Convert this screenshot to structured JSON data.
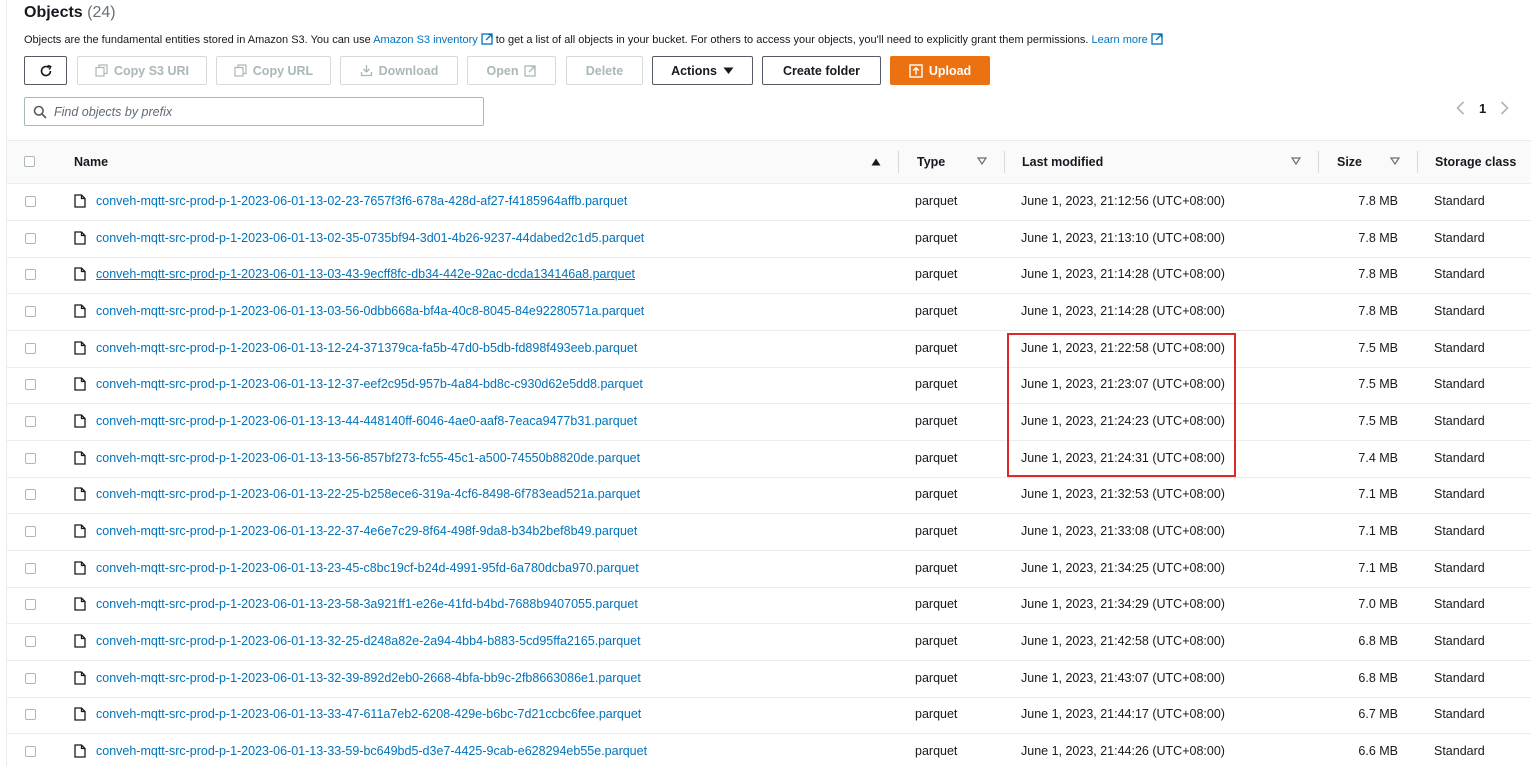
{
  "header": {
    "title": "Objects",
    "count": "(24)",
    "description_part1": "Objects are the fundamental entities stored in Amazon S3. You can use",
    "inventory_link": "Amazon S3 inventory",
    "description_part2": "to get a list of all objects in your bucket. For others to access your objects, you'll need to explicitly grant them permissions.",
    "learn_more_link": "Learn more"
  },
  "toolbar": {
    "copy_s3_uri": "Copy S3 URI",
    "copy_url": "Copy URL",
    "download": "Download",
    "open": "Open",
    "delete": "Delete",
    "actions": "Actions",
    "create_folder": "Create folder",
    "upload": "Upload"
  },
  "search": {
    "placeholder": "Find objects by prefix",
    "value": ""
  },
  "pagination": {
    "current_page": "1"
  },
  "table": {
    "columns": [
      "Name",
      "Type",
      "Last modified",
      "Size",
      "Storage class"
    ],
    "rows": [
      {
        "name": "conveh-mqtt-src-prod-p-1-2023-06-01-13-02-23-7657f3f6-678a-428d-af27-f4185964affb.parquet",
        "type": "parquet",
        "modified": "June 1, 2023, 21:12:56 (UTC+08:00)",
        "size": "7.8 MB",
        "storage": "Standard"
      },
      {
        "name": "conveh-mqtt-src-prod-p-1-2023-06-01-13-02-35-0735bf94-3d01-4b26-9237-44dabed2c1d5.parquet",
        "type": "parquet",
        "modified": "June 1, 2023, 21:13:10 (UTC+08:00)",
        "size": "7.8 MB",
        "storage": "Standard"
      },
      {
        "name": "conveh-mqtt-src-prod-p-1-2023-06-01-13-03-43-9ecff8fc-db34-442e-92ac-dcda134146a8.parquet",
        "type": "parquet",
        "modified": "June 1, 2023, 21:14:28 (UTC+08:00)",
        "size": "7.8 MB",
        "storage": "Standard"
      },
      {
        "name": "conveh-mqtt-src-prod-p-1-2023-06-01-13-03-56-0dbb668a-bf4a-40c8-8045-84e92280571a.parquet",
        "type": "parquet",
        "modified": "June 1, 2023, 21:14:28 (UTC+08:00)",
        "size": "7.8 MB",
        "storage": "Standard"
      },
      {
        "name": "conveh-mqtt-src-prod-p-1-2023-06-01-13-12-24-371379ca-fa5b-47d0-b5db-fd898f493eeb.parquet",
        "type": "parquet",
        "modified": "June 1, 2023, 21:22:58 (UTC+08:00)",
        "size": "7.5 MB",
        "storage": "Standard"
      },
      {
        "name": "conveh-mqtt-src-prod-p-1-2023-06-01-13-12-37-eef2c95d-957b-4a84-bd8c-c930d62e5dd8.parquet",
        "type": "parquet",
        "modified": "June 1, 2023, 21:23:07 (UTC+08:00)",
        "size": "7.5 MB",
        "storage": "Standard"
      },
      {
        "name": "conveh-mqtt-src-prod-p-1-2023-06-01-13-13-44-448140ff-6046-4ae0-aaf8-7eaca9477b31.parquet",
        "type": "parquet",
        "modified": "June 1, 2023, 21:24:23 (UTC+08:00)",
        "size": "7.5 MB",
        "storage": "Standard"
      },
      {
        "name": "conveh-mqtt-src-prod-p-1-2023-06-01-13-13-56-857bf273-fc55-45c1-a500-74550b8820de.parquet",
        "type": "parquet",
        "modified": "June 1, 2023, 21:24:31 (UTC+08:00)",
        "size": "7.4 MB",
        "storage": "Standard"
      },
      {
        "name": "conveh-mqtt-src-prod-p-1-2023-06-01-13-22-25-b258ece6-319a-4cf6-8498-6f783ead521a.parquet",
        "type": "parquet",
        "modified": "June 1, 2023, 21:32:53 (UTC+08:00)",
        "size": "7.1 MB",
        "storage": "Standard"
      },
      {
        "name": "conveh-mqtt-src-prod-p-1-2023-06-01-13-22-37-4e6e7c29-8f64-498f-9da8-b34b2bef8b49.parquet",
        "type": "parquet",
        "modified": "June 1, 2023, 21:33:08 (UTC+08:00)",
        "size": "7.1 MB",
        "storage": "Standard"
      },
      {
        "name": "conveh-mqtt-src-prod-p-1-2023-06-01-13-23-45-c8bc19cf-b24d-4991-95fd-6a780dcba970.parquet",
        "type": "parquet",
        "modified": "June 1, 2023, 21:34:25 (UTC+08:00)",
        "size": "7.1 MB",
        "storage": "Standard"
      },
      {
        "name": "conveh-mqtt-src-prod-p-1-2023-06-01-13-23-58-3a921ff1-e26e-41fd-b4bd-7688b9407055.parquet",
        "type": "parquet",
        "modified": "June 1, 2023, 21:34:29 (UTC+08:00)",
        "size": "7.0 MB",
        "storage": "Standard"
      },
      {
        "name": "conveh-mqtt-src-prod-p-1-2023-06-01-13-32-25-d248a82e-2a94-4bb4-b883-5cd95ffa2165.parquet",
        "type": "parquet",
        "modified": "June 1, 2023, 21:42:58 (UTC+08:00)",
        "size": "6.8 MB",
        "storage": "Standard"
      },
      {
        "name": "conveh-mqtt-src-prod-p-1-2023-06-01-13-32-39-892d2eb0-2668-4bfa-bb9c-2fb8663086e1.parquet",
        "type": "parquet",
        "modified": "June 1, 2023, 21:43:07 (UTC+08:00)",
        "size": "6.8 MB",
        "storage": "Standard"
      },
      {
        "name": "conveh-mqtt-src-prod-p-1-2023-06-01-13-33-47-611a7eb2-6208-429e-b6bc-7d21ccbc6fee.parquet",
        "type": "parquet",
        "modified": "June 1, 2023, 21:44:17 (UTC+08:00)",
        "size": "6.7 MB",
        "storage": "Standard"
      },
      {
        "name": "conveh-mqtt-src-prod-p-1-2023-06-01-13-33-59-bc649bd5-d3e7-4425-9cab-e628294eb55e.parquet",
        "type": "parquet",
        "modified": "June 1, 2023, 21:44:26 (UTC+08:00)",
        "size": "6.6 MB",
        "storage": "Standard"
      }
    ]
  },
  "colors": {
    "link": "#0073bb",
    "primary_button": "#ec7211",
    "highlight_box": "#e0282c"
  }
}
